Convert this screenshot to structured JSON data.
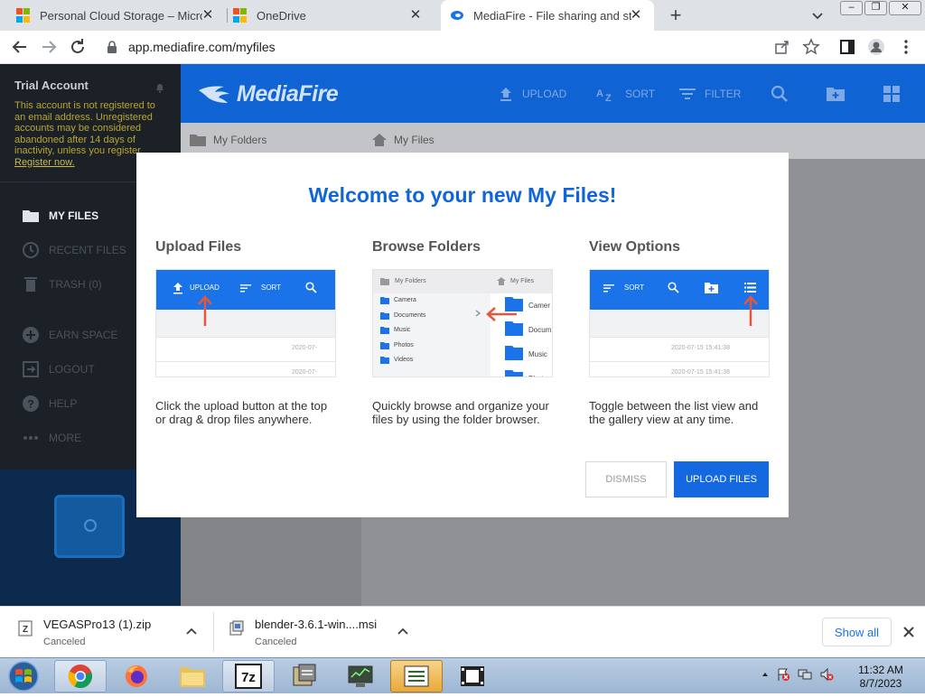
{
  "browser": {
    "tabs": [
      {
        "title": "Personal Cloud Storage – Microsoft",
        "icon": "microsoft-logo-icon"
      },
      {
        "title": "OneDrive",
        "icon": "microsoft-logo-icon"
      },
      {
        "title": "MediaFire - File sharing and storage",
        "icon": "mediafire-icon",
        "active": true
      }
    ],
    "url": "app.mediafire.com/myfiles"
  },
  "sidebar": {
    "trial_title": "Trial Account",
    "trial_text": "This account is not registered to an email address. Unregistered accounts may be considered abandoned after 14 days of inactivity, unless you register.",
    "register_link": "Register now.",
    "items": [
      {
        "label": "MY FILES",
        "icon": "folder-icon",
        "active": true
      },
      {
        "label": "RECENT FILES",
        "icon": "clock-icon"
      },
      {
        "label": "TRASH (0)",
        "icon": "trash-icon"
      },
      {
        "label": "EARN SPACE",
        "icon": "plus-circle-icon"
      },
      {
        "label": "LOGOUT",
        "icon": "logout-icon"
      },
      {
        "label": "HELP",
        "icon": "help-icon"
      },
      {
        "label": "MORE",
        "icon": "more-icon"
      }
    ]
  },
  "header": {
    "logo": "MediaFire",
    "upload": "UPLOAD",
    "sort": "SORT",
    "filter": "FILTER"
  },
  "breadcrumbs": {
    "folders": "My Folders",
    "files": "My Files"
  },
  "modal": {
    "title": "Welcome to your new My Files!",
    "columns": [
      {
        "title": "Upload Files",
        "desc": "Click the upload button at the top or drag & drop files anywhere."
      },
      {
        "title": "Browse Folders",
        "desc": "Quickly browse and organize your files by using the folder browser."
      },
      {
        "title": "View Options",
        "desc": "Toggle between the list view and the gallery view at any time."
      }
    ],
    "illus": {
      "upload": "UPLOAD",
      "sort": "SORT",
      "date1": "2020-07-",
      "my_folders": "My Folders",
      "my_files": "My Files",
      "folders": [
        "Camera",
        "Documents",
        "Music",
        "Photos",
        "Videos"
      ],
      "right_folders": [
        "Camer",
        "Docum",
        "Music",
        "Photos"
      ],
      "date_full1": "2020-07-15 15:41:38",
      "date_full2": "2020-07-15 15:41:38"
    },
    "dismiss": "DISMISS",
    "upload_files": "UPLOAD FILES"
  },
  "downloads": {
    "items": [
      {
        "name": "VEGASPro13 (1).zip",
        "status": "Canceled"
      },
      {
        "name": "blender-3.6.1-win....msi",
        "status": "Canceled"
      }
    ],
    "show_all": "Show all"
  },
  "taskbar": {
    "time": "11:32 AM",
    "date": "8/7/2023"
  },
  "colors": {
    "mediafire_blue": "#1063d2",
    "modal_title": "#1165d8",
    "sidebar_bg": "#1c2027",
    "trial_text": "#b8a62e"
  }
}
